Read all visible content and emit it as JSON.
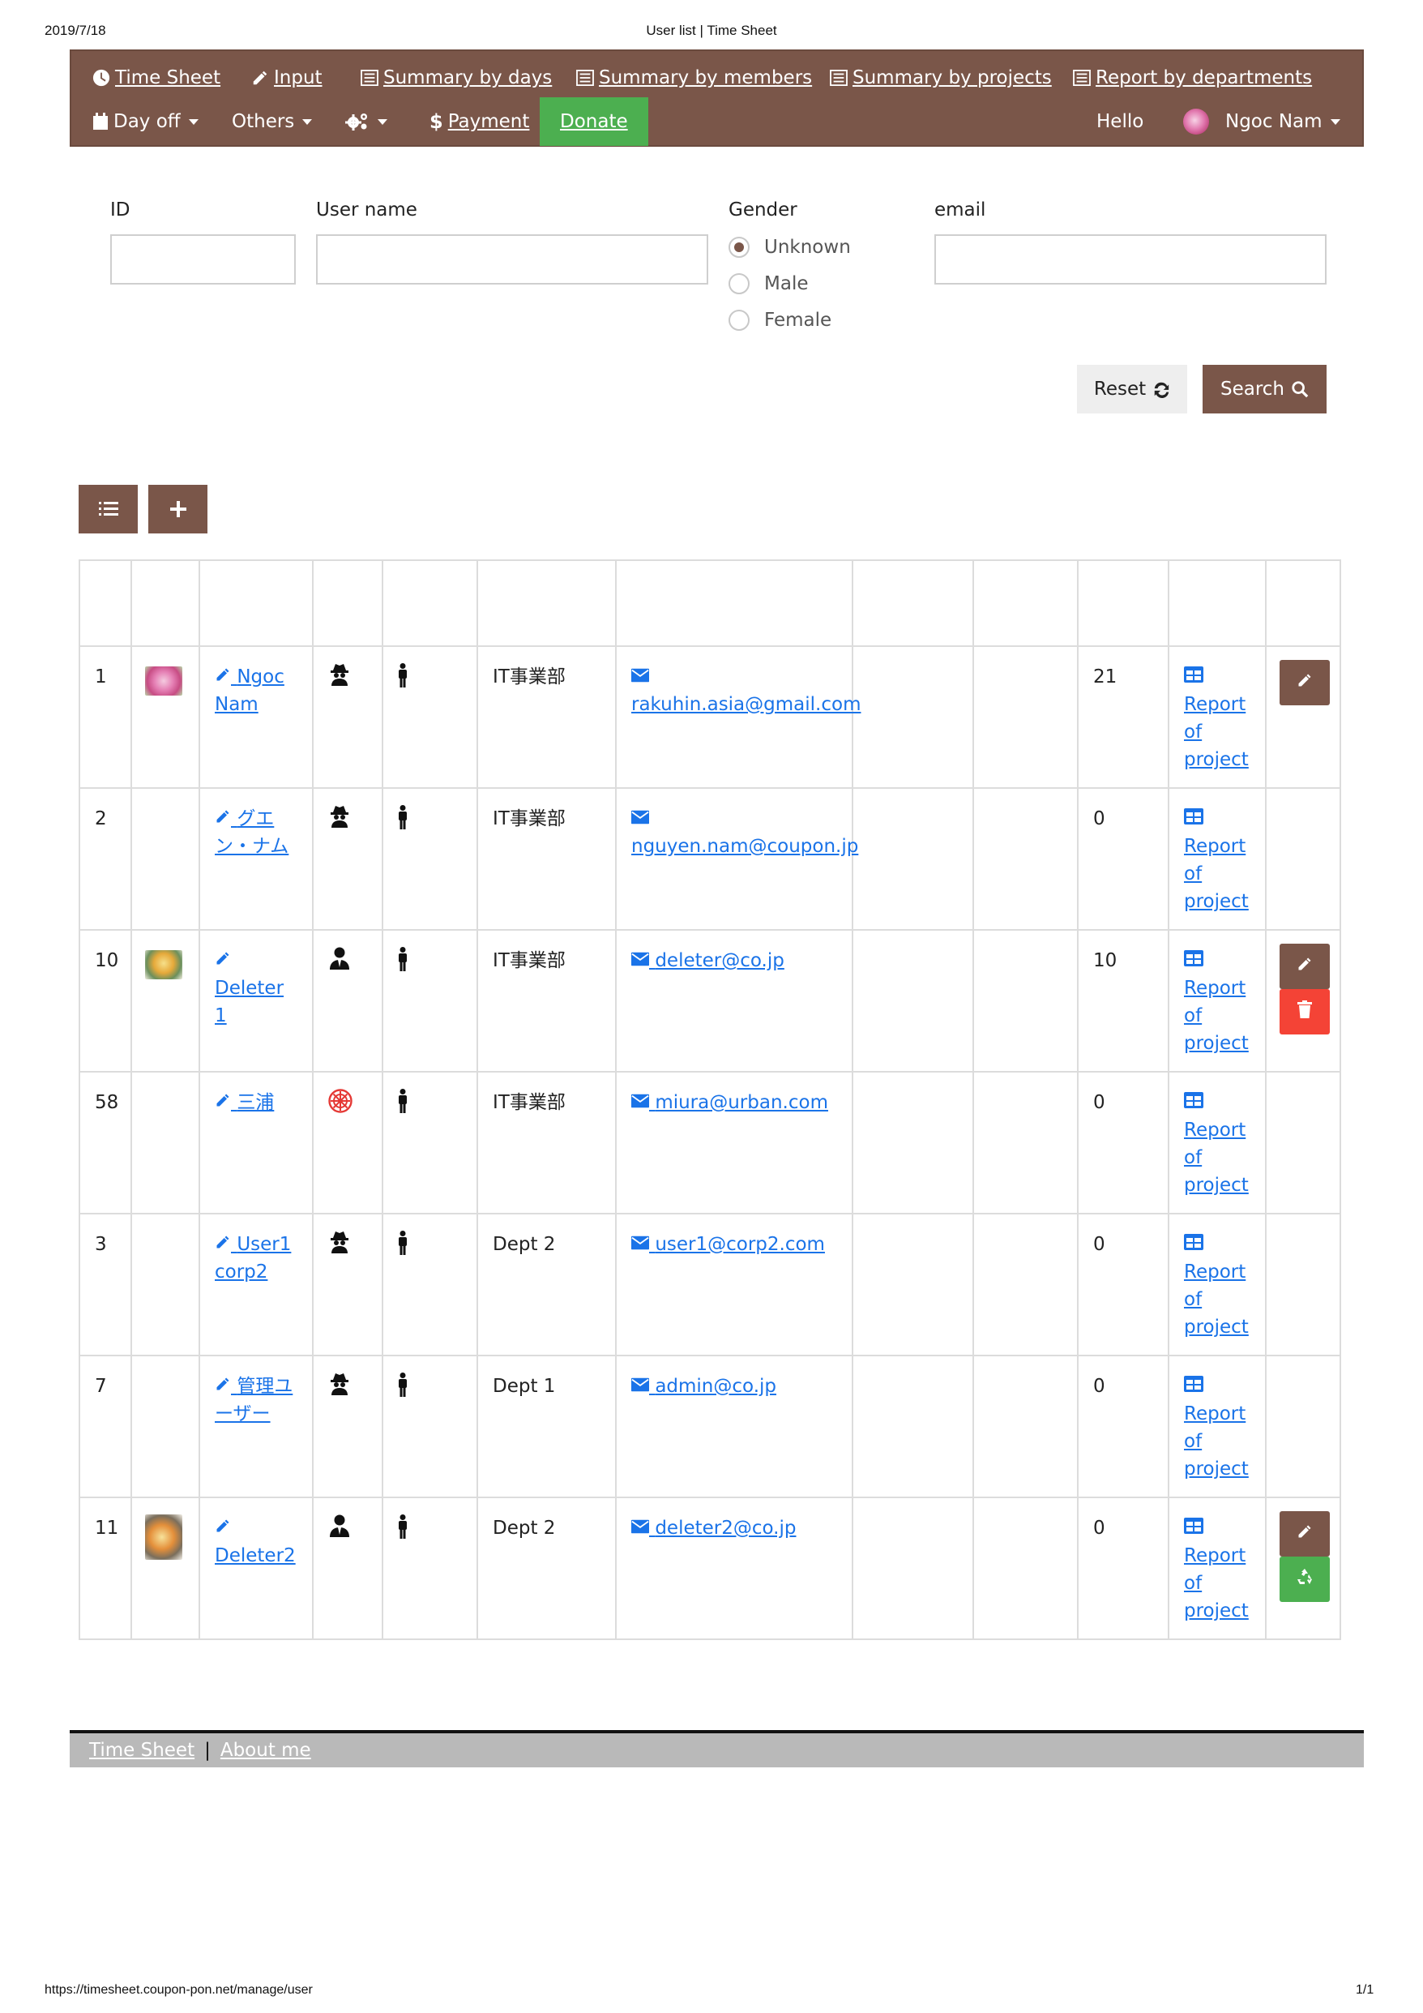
{
  "print_header": {
    "date": "2019/7/18",
    "title": "User list | Time Sheet"
  },
  "print_footer": {
    "url": "https://timesheet.coupon-pon.net/manage/user",
    "page": "1/1"
  },
  "nav": {
    "row1": [
      {
        "label": "Time Sheet",
        "icon": "clock-icon"
      },
      {
        "label": "Input",
        "icon": "pencil-icon"
      },
      {
        "label": "Summary by days",
        "icon": "list-icon"
      },
      {
        "label": "Summary by members",
        "icon": "list-icon"
      },
      {
        "label": "Summary by projects",
        "icon": "list-icon"
      },
      {
        "label": "Report by departments",
        "icon": "list-icon"
      }
    ],
    "row2": {
      "day_off": "Day off",
      "others": "Others",
      "payment": "Payment",
      "donate": "Donate",
      "hello": "Hello",
      "user": "Ngoc Nam"
    },
    "colors": {
      "brand": "#7a5649",
      "donate": "#4caf50"
    }
  },
  "search_form": {
    "id_label": "ID",
    "id_value": "",
    "username_label": "User name",
    "username_value": "",
    "gender_label": "Gender",
    "gender_options": [
      "Unknown",
      "Male",
      "Female"
    ],
    "gender_selected": "Unknown",
    "email_label": "email",
    "email_value": "",
    "reset_label": "Reset",
    "search_label": "Search"
  },
  "toolbar": {
    "list_icon": "list-icon",
    "add_icon": "plus-icon"
  },
  "table": {
    "rows": [
      {
        "id": "1",
        "name": "Ngoc Nam",
        "role_icon": "spy-icon",
        "dept": "IT事業部",
        "email": "rakuhin.asia@gmail.com",
        "count": "21",
        "report": "Report of project",
        "actions": [
          "edit"
        ]
      },
      {
        "id": "2",
        "name": "グエン・ナム",
        "role_icon": "spy-icon",
        "dept": "IT事業部",
        "email": "nguyen.nam@coupon.jp",
        "count": "0",
        "report": "Report of project",
        "actions": []
      },
      {
        "id": "10",
        "name": "Deleter 1",
        "role_icon": "user-tie-icon",
        "dept": "IT事業部",
        "email": "deleter@co.jp",
        "count": "10",
        "report": "Report of project",
        "actions": [
          "edit",
          "delete"
        ]
      },
      {
        "id": "58",
        "name": "三浦",
        "role_icon": "empire-icon",
        "dept": "IT事業部",
        "email": "miura@urban.com",
        "count": "0",
        "report": "Report of project",
        "actions": []
      },
      {
        "id": "3",
        "name": "User1 corp2",
        "role_icon": "spy-icon",
        "dept": "Dept 2",
        "email": "user1@corp2.com",
        "count": "0",
        "report": "Report of project",
        "actions": []
      },
      {
        "id": "7",
        "name": "管理ユーザー",
        "role_icon": "spy-icon",
        "dept": "Dept 1",
        "email": "admin@co.jp",
        "count": "0",
        "report": "Report of project",
        "actions": []
      },
      {
        "id": "11",
        "name": "Deleter2",
        "role_icon": "user-tie-icon",
        "dept": "Dept 2",
        "email": "deleter2@co.jp",
        "count": "0",
        "report": "Report of project",
        "actions": [
          "edit",
          "recycle"
        ]
      }
    ]
  },
  "footer": {
    "link1": "Time Sheet",
    "separator": "|",
    "link2": "About me"
  }
}
